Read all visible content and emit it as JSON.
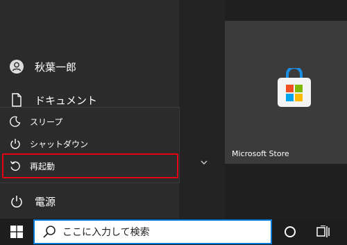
{
  "start_menu": {
    "user": {
      "name": "秋葉一郎",
      "icon": "user-icon"
    },
    "documents": {
      "label": "ドキュメント",
      "icon": "document-icon"
    },
    "power": {
      "label": "電源",
      "icon": "power-icon"
    }
  },
  "power_menu": {
    "items": [
      {
        "label": "スリープ",
        "icon": "moon-icon"
      },
      {
        "label": "シャットダウン",
        "icon": "power-icon"
      },
      {
        "label": "再起動",
        "icon": "restart-icon"
      }
    ],
    "highlighted_item": "再起動",
    "highlight_color": "#e60012"
  },
  "tiles": [
    {
      "label": "Microsoft Store",
      "icon": "microsoft-store-icon"
    }
  ],
  "taskbar": {
    "search_placeholder": "ここに入力して検索",
    "start_icon": "windows-logo-icon",
    "search_icon": "search-icon",
    "cortana_icon": "cortana-icon",
    "task_view_icon": "task-view-icon",
    "accent_color": "#0078d7"
  }
}
